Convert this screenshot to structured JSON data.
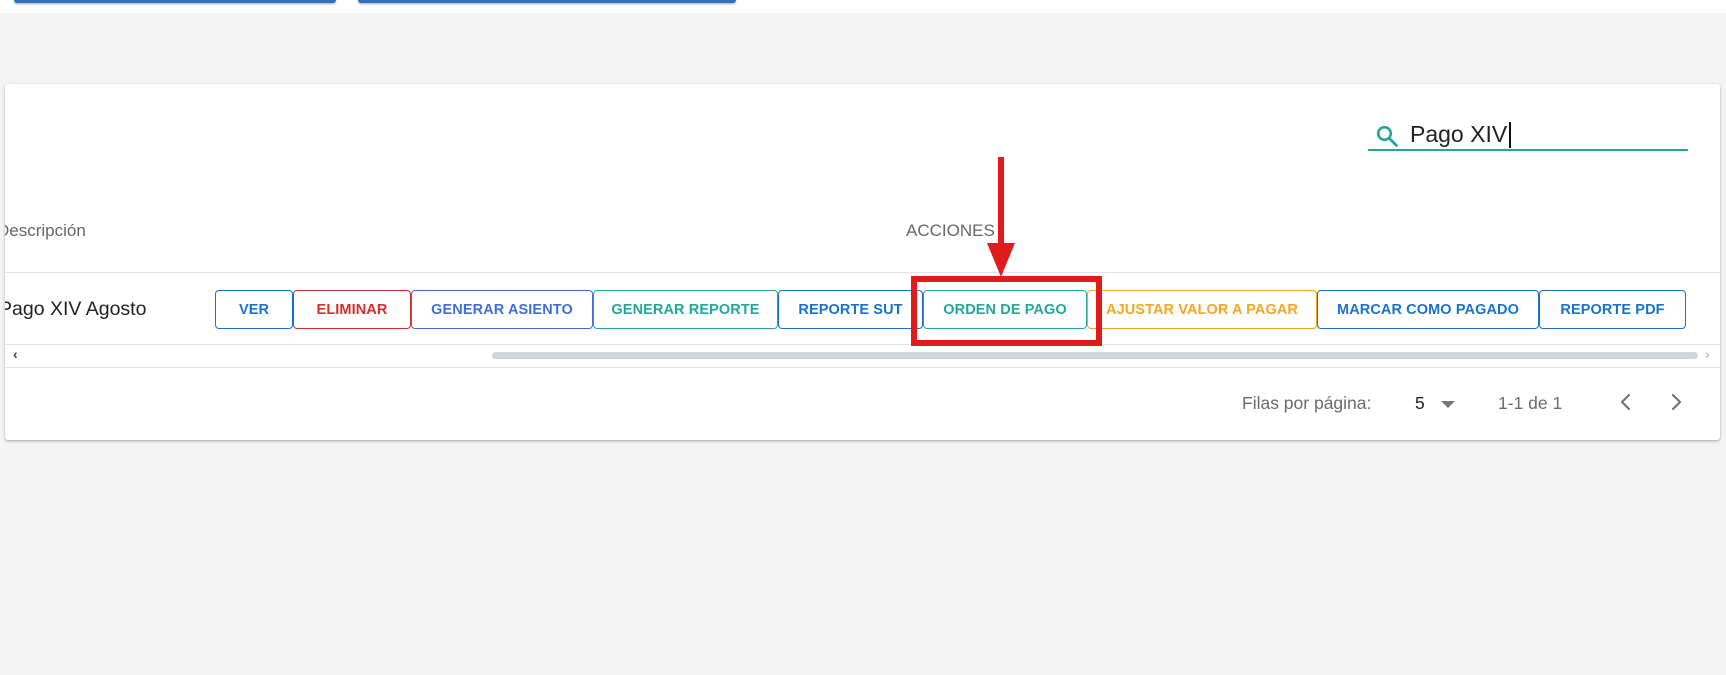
{
  "search": {
    "value": "Pago XIV"
  },
  "table": {
    "headers": {
      "description": "Descripción",
      "actions": "ACCIONES"
    },
    "rows": [
      {
        "description": "Pago XIV Agosto"
      }
    ],
    "actions": [
      {
        "label": "VER",
        "color": "#1a73c9"
      },
      {
        "label": "ELIMINAR",
        "color": "#d32f2f"
      },
      {
        "label": "GENERAR ASIENTO",
        "color": "#3f6fd6"
      },
      {
        "label": "GENERAR REPORTE",
        "color": "#26a69a"
      },
      {
        "label": "REPORTE SUT",
        "color": "#1a73c9"
      },
      {
        "label": "ORDEN DE PAGO",
        "color": "#26a69a"
      },
      {
        "label": "AJUSTAR VALOR A PAGAR",
        "color": "#f5a623"
      },
      {
        "label": "MARCAR COMO PAGADO",
        "color": "#1a73c9"
      },
      {
        "label": "REPORTE PDF",
        "color": "#1a73c9"
      }
    ]
  },
  "pagination": {
    "rows_per_page_label": "Filas por página:",
    "rows_per_page_value": "5",
    "range": "1-1 de 1"
  },
  "icons": {
    "search": "search-icon",
    "select": "chevron-down-icon",
    "prev": "chevron-left-icon",
    "next": "chevron-right-icon"
  },
  "colors": {
    "accent": "#26a69a",
    "annotation": "#e01b1b"
  }
}
